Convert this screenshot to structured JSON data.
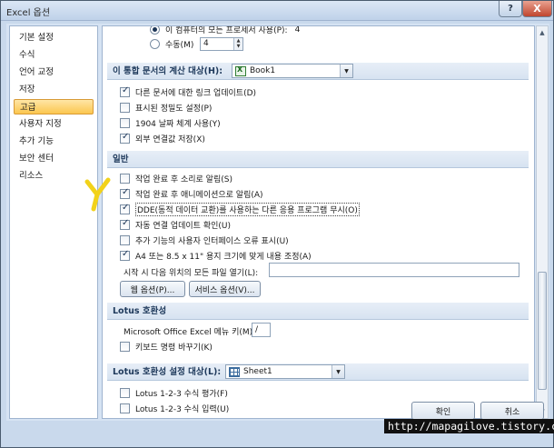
{
  "window": {
    "title": "Excel 옵션",
    "help_glyph": "?",
    "close_glyph": "X"
  },
  "sidebar": {
    "items": [
      {
        "label": "기본 설정"
      },
      {
        "label": "수식"
      },
      {
        "label": "언어 교정"
      },
      {
        "label": "저장"
      },
      {
        "label": "고급"
      },
      {
        "label": "사용자 지정"
      },
      {
        "label": "추가 기능"
      },
      {
        "label": "보안 센터"
      },
      {
        "label": "리소스"
      }
    ],
    "active_index": 4
  },
  "top_partial": {
    "radio_all_label": "이 컴퓨터의 모든 프로세서 사용(P):",
    "radio_all_value": "4",
    "radio_manual_label": "수동(M)",
    "manual_value": "4"
  },
  "calc_section": {
    "header": "이 통합 문서의 계산 대상(H):",
    "workbook": "Book1",
    "options": [
      {
        "label": "다른 문서에 대한 링크 업데이트(D)",
        "checked": true
      },
      {
        "label": "표시된 정밀도 설정(P)",
        "checked": false
      },
      {
        "label": "1904 날짜 체계 사용(Y)",
        "checked": false
      },
      {
        "label": "외부 연결값 저장(X)",
        "checked": true
      }
    ]
  },
  "general_section": {
    "header": "일반",
    "options": [
      {
        "label": "작업 완료 후 소리로 알림(S)",
        "checked": false
      },
      {
        "label": "작업 완료 후 애니메이션으로 알림(A)",
        "checked": true
      },
      {
        "label": "DDE(동적 데이터 교환)를 사용하는 다른 응용 프로그램 무시(O)",
        "checked": true
      },
      {
        "label": "자동 연결 업데이트 확인(U)",
        "checked": true
      },
      {
        "label": "추가 기능의 사용자 인터페이스 오류 표시(U)",
        "checked": false
      },
      {
        "label": "A4 또는 8.5 x 11\" 용지 크기에 맞게 내용 조정(A)",
        "checked": true
      }
    ],
    "startup_label": "시작 시 다음 위치의 모든 파일 열기(L):",
    "startup_value": "",
    "web_options_button": "웹 옵션(P)...",
    "service_options_button": "서비스 옵션(V)..."
  },
  "lotus_section": {
    "header": "Lotus 호환성",
    "menu_key_label": "Microsoft Office Excel 메뉴 키(M):",
    "menu_key_value": "/",
    "nav_keys_label": "키보드 명령 바꾸기(K)",
    "nav_keys_checked": false
  },
  "lotus_settings_section": {
    "header": "Lotus 호환성 설정 대상(L):",
    "sheet": "Sheet1",
    "options": [
      {
        "label": "Lotus 1-2-3 수식 평가(F)",
        "checked": false
      },
      {
        "label": "Lotus 1-2-3 수식 입력(U)",
        "checked": false
      }
    ]
  },
  "footer": {
    "ok_label": "확인",
    "cancel_label": "취소"
  },
  "watermark": "http://mapagilove.tistory.com",
  "colors": {
    "accent": "#fbc64f",
    "section_text": "#1e395b",
    "annotation_mark": "#f2d21a"
  }
}
